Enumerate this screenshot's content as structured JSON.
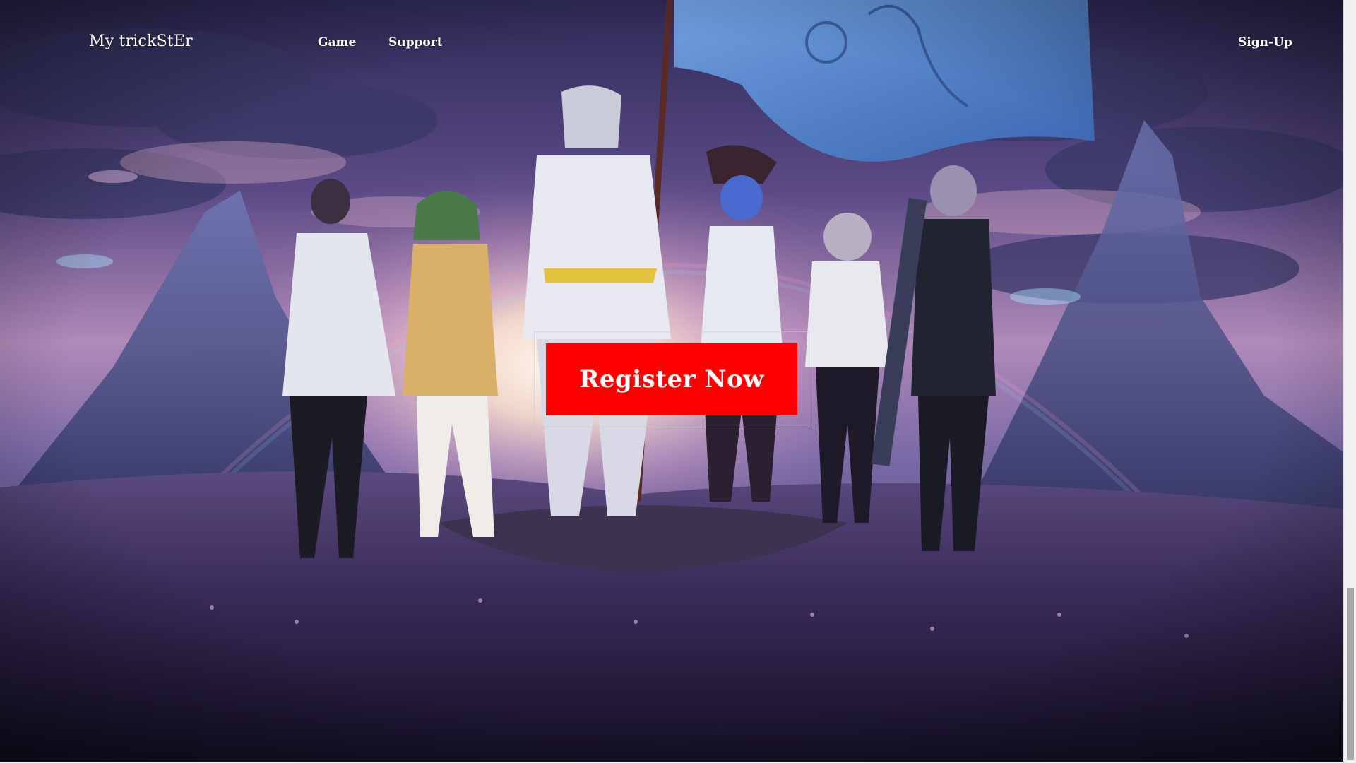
{
  "header": {
    "brand": "My trickStEr",
    "nav": [
      {
        "label": "Game"
      },
      {
        "label": "Support"
      }
    ],
    "signup_label": "Sign-Up"
  },
  "hero": {
    "cta_label": "Register Now",
    "cta_color": "#ff0000",
    "sky_top_color": "#3b3566",
    "horizon_glow_color": "#fff4e6",
    "ground_color": "#2a1f44",
    "flag_color": "#4f7fc8"
  },
  "scrollbar": {
    "position": 0.77
  }
}
